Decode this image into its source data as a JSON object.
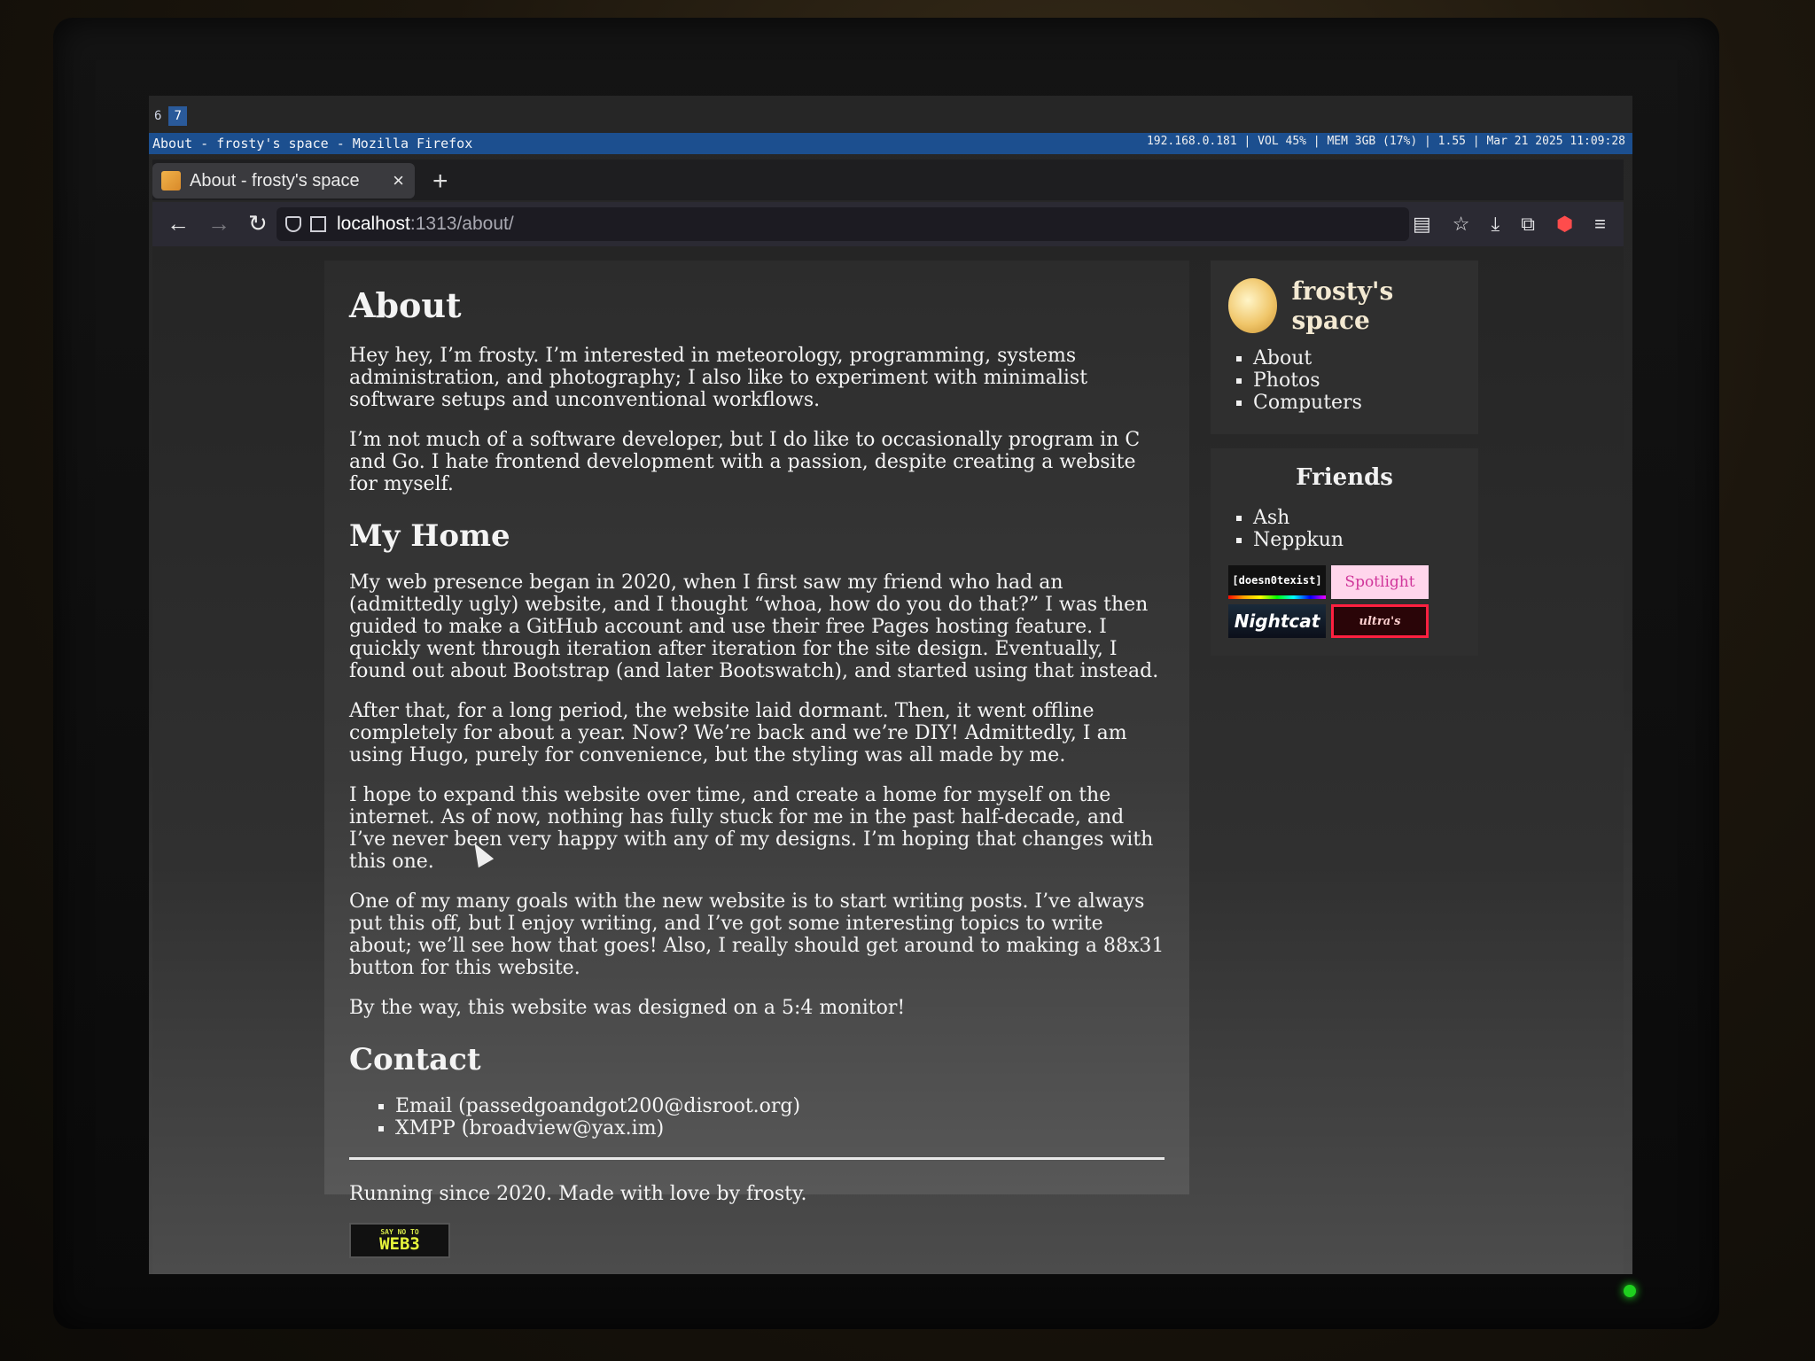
{
  "wm": {
    "workspaces": [
      "6",
      "7"
    ],
    "window_title": "About - frosty's space - Mozilla Firefox",
    "status": "192.168.0.181 | VOL 45% | MEM 3GB (17%) | 1.55 | Mar 21 2025 11:09:28"
  },
  "browser": {
    "tab_title": "About - frosty's space",
    "tab_close": "×",
    "new_tab": "+",
    "back": "←",
    "forward": "→",
    "reload": "↻",
    "url_host": "localhost",
    "url_path": ":1313/about/",
    "toolbar_icons": [
      "reader-view-icon",
      "bookmark-star-icon",
      "download-icon",
      "extensions-icon",
      "ublock-icon",
      "menu-icon"
    ]
  },
  "page": {
    "title": "About",
    "intro": [
      "Hey hey, I’m frosty. I’m interested in meteorology, programming, systems administration, and photography; I also like to experiment with minimalist software setups and unconventional workflows.",
      "I’m not much of a software developer, but I do like to occasionally program in C and Go. I hate frontend development with a passion, despite creating a website for myself."
    ],
    "home_heading": "My Home",
    "home": [
      "My web presence began in 2020, when I first saw my friend who had an (admittedly ugly) website, and I thought “whoa, how do you do that?” I was then guided to make a GitHub account and use their free Pages hosting feature. I quickly went through iteration after iteration for the site design. Eventually, I found out about Bootstrap (and later Bootswatch), and started using that instead.",
      "After that, for a long period, the website laid dormant. Then, it went offline completely for about a year. Now? We’re back and we’re DIY! Admittedly, I am using Hugo, purely for convenience, but the styling was all made by me.",
      "I hope to expand this website over time, and create a home for myself on the internet. As of now, nothing has fully stuck for me in the past half-decade, and I’ve never been very happy with any of my designs. I’m hoping that changes with this one.",
      "One of my many goals with the new website is to start writing posts. I’ve always put this off, but I enjoy writing, and I’ve got some interesting topics to write about; we’ll see how that goes! Also, I really should get around to making a 88x31 button for this website.",
      "By the way, this website was designed on a 5:4 monitor!"
    ],
    "contact_heading": "Contact",
    "contact": [
      "Email (passedgoandgot200@disroot.org)",
      "XMPP (broadview@yax.im)"
    ],
    "footer": "Running since 2020. Made with love by frosty.",
    "web3_small": "SAY NO TO",
    "web3_big": "WEB3"
  },
  "sidebar": {
    "site_name": "frosty's space",
    "nav": [
      "About",
      "Photos",
      "Computers"
    ],
    "friends_heading": "Friends",
    "friends": [
      "Ash",
      "Neppkun"
    ],
    "buttons": [
      "[doesn0texist]",
      "Spotlight",
      "Nightcat",
      "ultra's"
    ]
  }
}
